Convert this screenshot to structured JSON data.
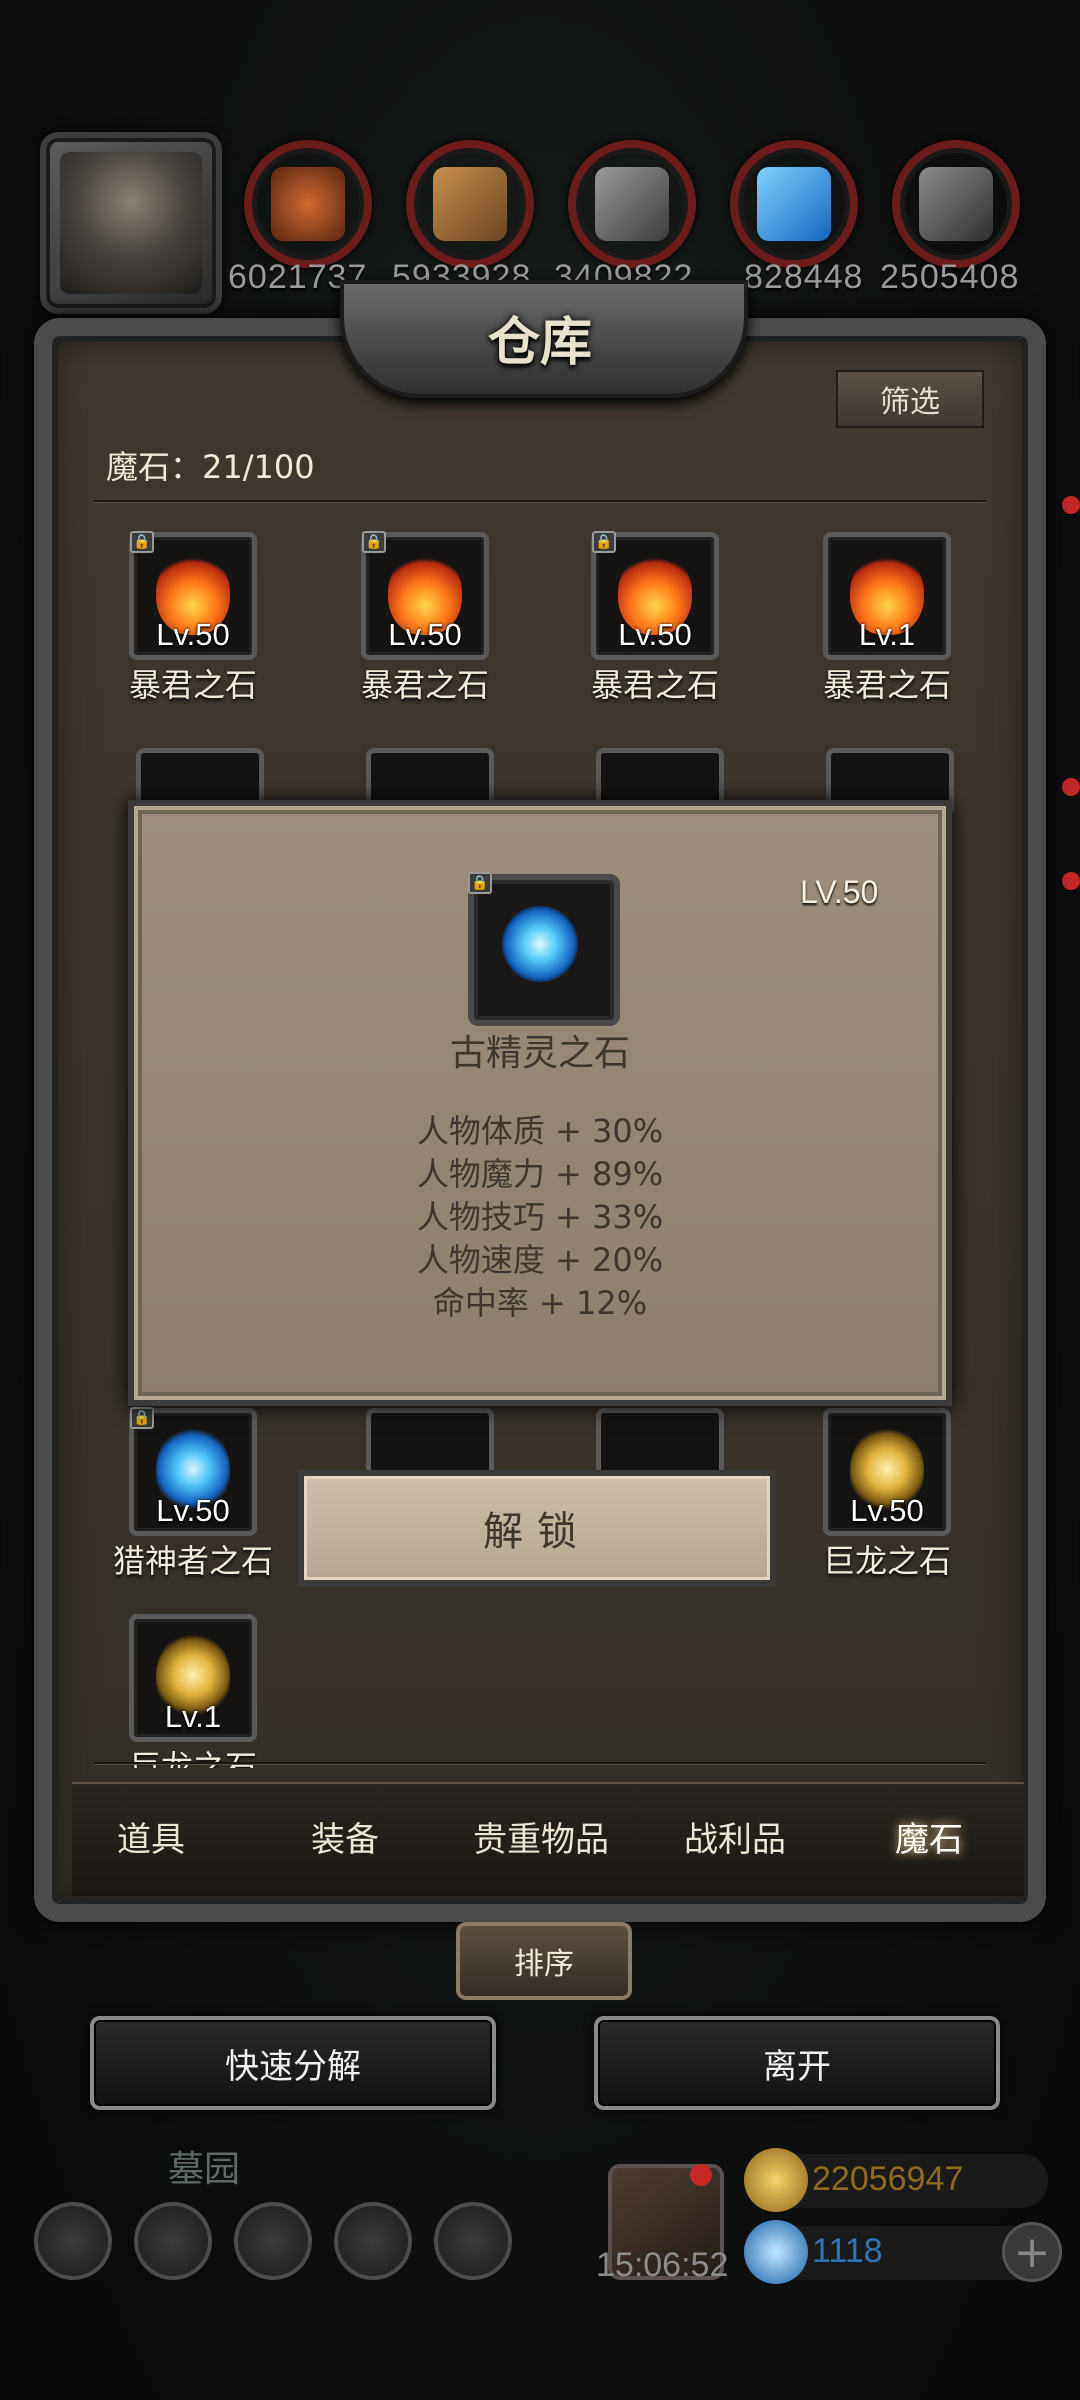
{
  "top_bar": {
    "resources": [
      {
        "icon": "meat-icon",
        "count": "6021737",
        "color": "#b5542a"
      },
      {
        "icon": "wood-icon",
        "count": "5933928",
        "color": "#a2713e"
      },
      {
        "icon": "iron-icon",
        "count": "3409822",
        "color": "#7a7a7a"
      },
      {
        "icon": "crystal-icon",
        "count": "828448",
        "color": "#3aa6e8"
      },
      {
        "icon": "stone-icon",
        "count": "2505408",
        "color": "#6a6a6a"
      }
    ]
  },
  "warehouse": {
    "title": "仓库",
    "filter_label": "筛选",
    "count_label": "魔石：21/100",
    "items_row1": [
      {
        "level": "Lv.50",
        "name": "暴君之石",
        "type": "fire",
        "locked": true
      },
      {
        "level": "Lv.50",
        "name": "暴君之石",
        "type": "fire",
        "locked": true
      },
      {
        "level": "Lv.50",
        "name": "暴君之石",
        "type": "fire",
        "locked": true
      },
      {
        "level": "Lv.1",
        "name": "暴君之石",
        "type": "fire",
        "locked": false
      }
    ],
    "items_row_bottom": [
      {
        "level": "Lv.50",
        "name": "猎神者之石",
        "type": "blue",
        "locked": true
      },
      {
        "level": "Lv.50",
        "name": "巨龙之石",
        "type": "gold",
        "locked": false
      }
    ],
    "items_last": [
      {
        "level": "Lv.1",
        "name": "巨龙之石",
        "type": "gold",
        "locked": false
      }
    ]
  },
  "tooltip": {
    "level": "LV.50",
    "name": "古精灵之石",
    "stats": [
      "人物体质 + 30%",
      "人物魔力 + 89%",
      "人物技巧 + 33%",
      "人物速度 + 20%",
      "命中率 + 12%"
    ],
    "unlock_label": "解锁"
  },
  "tabs": [
    "道具",
    "装备",
    "贵重物品",
    "战利品",
    "魔石"
  ],
  "active_tab": "魔石",
  "sort_label": "排序",
  "actions": {
    "quick_decompose": "快速分解",
    "leave": "离开"
  },
  "bottom": {
    "zone": "墓园",
    "timer": "15:06:52",
    "gold": "22056947",
    "gems": "1118",
    "gold_color": "#c8a033",
    "gem_color": "#3b8ed6"
  }
}
